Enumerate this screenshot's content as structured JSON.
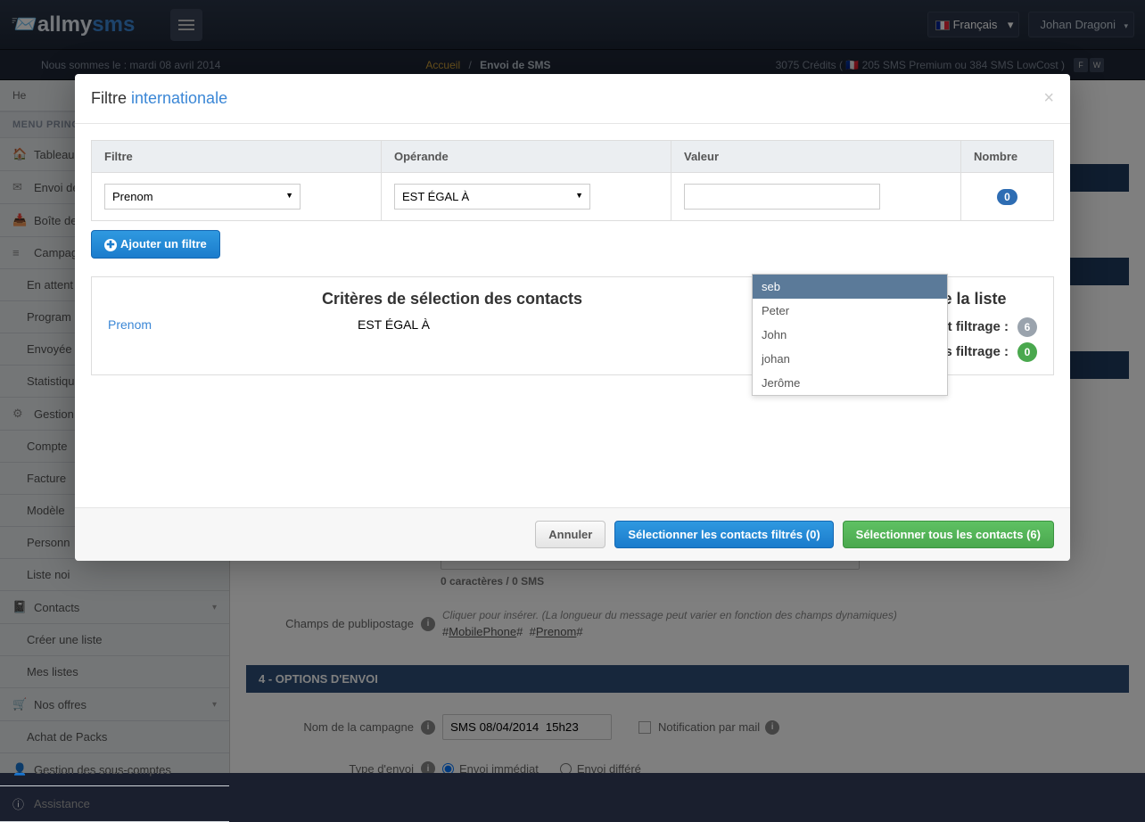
{
  "header": {
    "logo_allmy": "allmy",
    "logo_sms": "sms",
    "language": "Français",
    "user": "Johan Dragoni"
  },
  "subheader": {
    "date": "Nous sommes le : mardi 08 avril 2014",
    "bc_home": "Accueil",
    "bc_current": "Envoi de SMS",
    "credits": "3075 Crédits ( 🇫🇷 205 SMS Premium ou 384 SMS LowCost )",
    "b1": "F",
    "b2": "W"
  },
  "sidebar": {
    "welcome": "He",
    "title": "MENU PRINC",
    "items": [
      {
        "label": "Tableau"
      },
      {
        "label": "Envoi de"
      },
      {
        "label": "Boîte de"
      },
      {
        "label": "Campag"
      }
    ],
    "sub_campaign": [
      {
        "label": "En attent"
      },
      {
        "label": "Program"
      },
      {
        "label": "Envoyée"
      },
      {
        "label": "Statistiqu"
      }
    ],
    "gestion": "Gestion",
    "sub_gestion": [
      {
        "label": "Compte"
      },
      {
        "label": "Facture"
      },
      {
        "label": "Modèle"
      },
      {
        "label": "Personn"
      },
      {
        "label": "Liste noi"
      }
    ],
    "contacts": "Contacts",
    "sub_contacts": [
      {
        "label": "Créer une liste"
      },
      {
        "label": "Mes listes"
      }
    ],
    "offers": "Nos offres",
    "sub_offers": [
      {
        "label": "Achat de Packs"
      }
    ],
    "sous": "Gestion des sous-comptes",
    "assist": "Assistance"
  },
  "main": {
    "counter": "0 caractères / 0 SMS",
    "merge_label": "Champs de publipostage",
    "merge_hint": "Cliquer pour insérer. (La longueur du message peut varier en fonction des champs dynamiques)",
    "merge_f1": "MobilePhone",
    "merge_f2": "Prenom",
    "section4": "4 - OPTIONS D'ENVOI",
    "camp_label": "Nom de la campagne",
    "camp_val": "SMS 08/04/2014  15h23",
    "notif": "Notification par mail",
    "type_label": "Type d'envoi",
    "r1": "Envoi immédiat",
    "r2": "Envoi différé"
  },
  "modal": {
    "title_a": "Filtre ",
    "title_b": "internationale",
    "th_filtre": "Filtre",
    "th_op": "Opérande",
    "th_val": "Valeur",
    "th_nb": "Nombre",
    "sel_filtre": "Prenom",
    "sel_op": "EST ÉGAL À",
    "nb": "0",
    "add_filter": "Ajouter un filtre",
    "crit_title": "Critères de sélection des contacts",
    "crit_f": "Prenom",
    "crit_op": "EST ÉGAL À",
    "list_title": "Contacts de la liste",
    "before": "Avant filtrage :",
    "before_v": "6",
    "after": "Après filtrage :",
    "after_v": "0",
    "btn_cancel": "Annuler",
    "btn_filtered": "Sélectionner les contacts filtrés (0)",
    "btn_all": "Sélectionner tous les contacts (6)"
  },
  "autocomplete": {
    "o1": "seb",
    "o2": "Peter",
    "o3": "John",
    "o4": "johan",
    "o5": "Jerôme"
  }
}
